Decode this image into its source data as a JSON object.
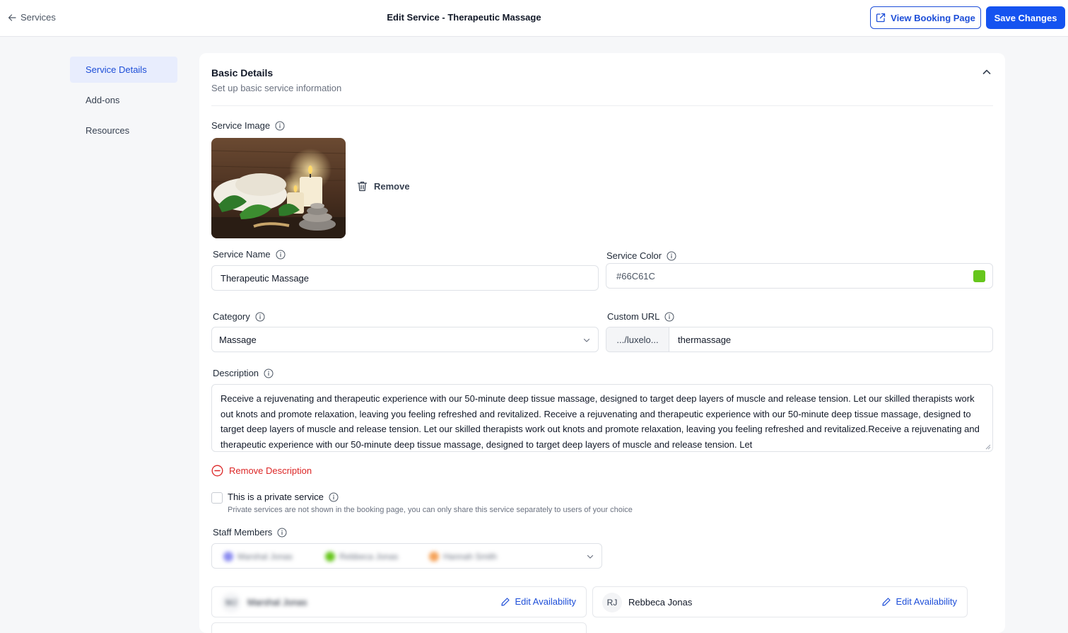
{
  "header": {
    "back_label": "Services",
    "title": "Edit Service - Therapeutic Massage",
    "view_booking_label": "View Booking Page",
    "save_label": "Save Changes"
  },
  "sidebar": {
    "items": [
      {
        "label": "Service Details",
        "active": true
      },
      {
        "label": "Add-ons",
        "active": false
      },
      {
        "label": "Resources",
        "active": false
      }
    ]
  },
  "section": {
    "title": "Basic Details",
    "subtitle": "Set up basic service information"
  },
  "form": {
    "service_image_label": "Service Image",
    "remove_image_label": "Remove",
    "service_name_label": "Service Name",
    "service_name_value": "Therapeutic Massage",
    "service_color_label": "Service Color",
    "service_color_value": "#66C61C",
    "category_label": "Category",
    "category_value": "Massage",
    "custom_url_label": "Custom URL",
    "custom_url_prefix": ".../luxelo...",
    "custom_url_value": "thermassage",
    "description_label": "Description",
    "description_value": "Receive a rejuvenating and therapeutic experience with our 50-minute deep tissue massage, designed to target deep layers of muscle and release tension. Let our skilled therapists work out knots and promote relaxation, leaving you feeling refreshed and revitalized. Receive a rejuvenating and therapeutic experience with our 50-minute deep tissue massage, designed to target deep layers of muscle and release tension. Let our skilled therapists work out knots and promote relaxation, leaving you feeling refreshed and revitalized.Receive a rejuvenating and therapeutic experience with our 50-minute deep tissue massage, designed to target deep layers of muscle and release tension. Let",
    "remove_description_label": "Remove Description",
    "private_label": "This is a private service",
    "private_help": "Private services are not shown in the booking page, you can only share this service separately to users of your choice",
    "private_checked": false,
    "staff_label": "Staff Members"
  },
  "staff_select": {
    "chips": [
      {
        "label": "Marshal Jonas",
        "color": "#8b8cf0"
      },
      {
        "label": "Rebbeca Jonas",
        "color": "#66C61C"
      },
      {
        "label": "Hannah Smith",
        "color": "#f5a35a"
      }
    ]
  },
  "staff_cards": [
    {
      "initials": "MJ",
      "name": "Marshal Jonas",
      "edit_label": "Edit Availability",
      "blurred": true
    },
    {
      "initials": "RJ",
      "name": "Rebbeca Jonas",
      "edit_label": "Edit Availability",
      "blurred": false
    }
  ],
  "colors": {
    "primary": "#1553f0",
    "danger": "#dc2626",
    "service_color": "#66C61C"
  }
}
